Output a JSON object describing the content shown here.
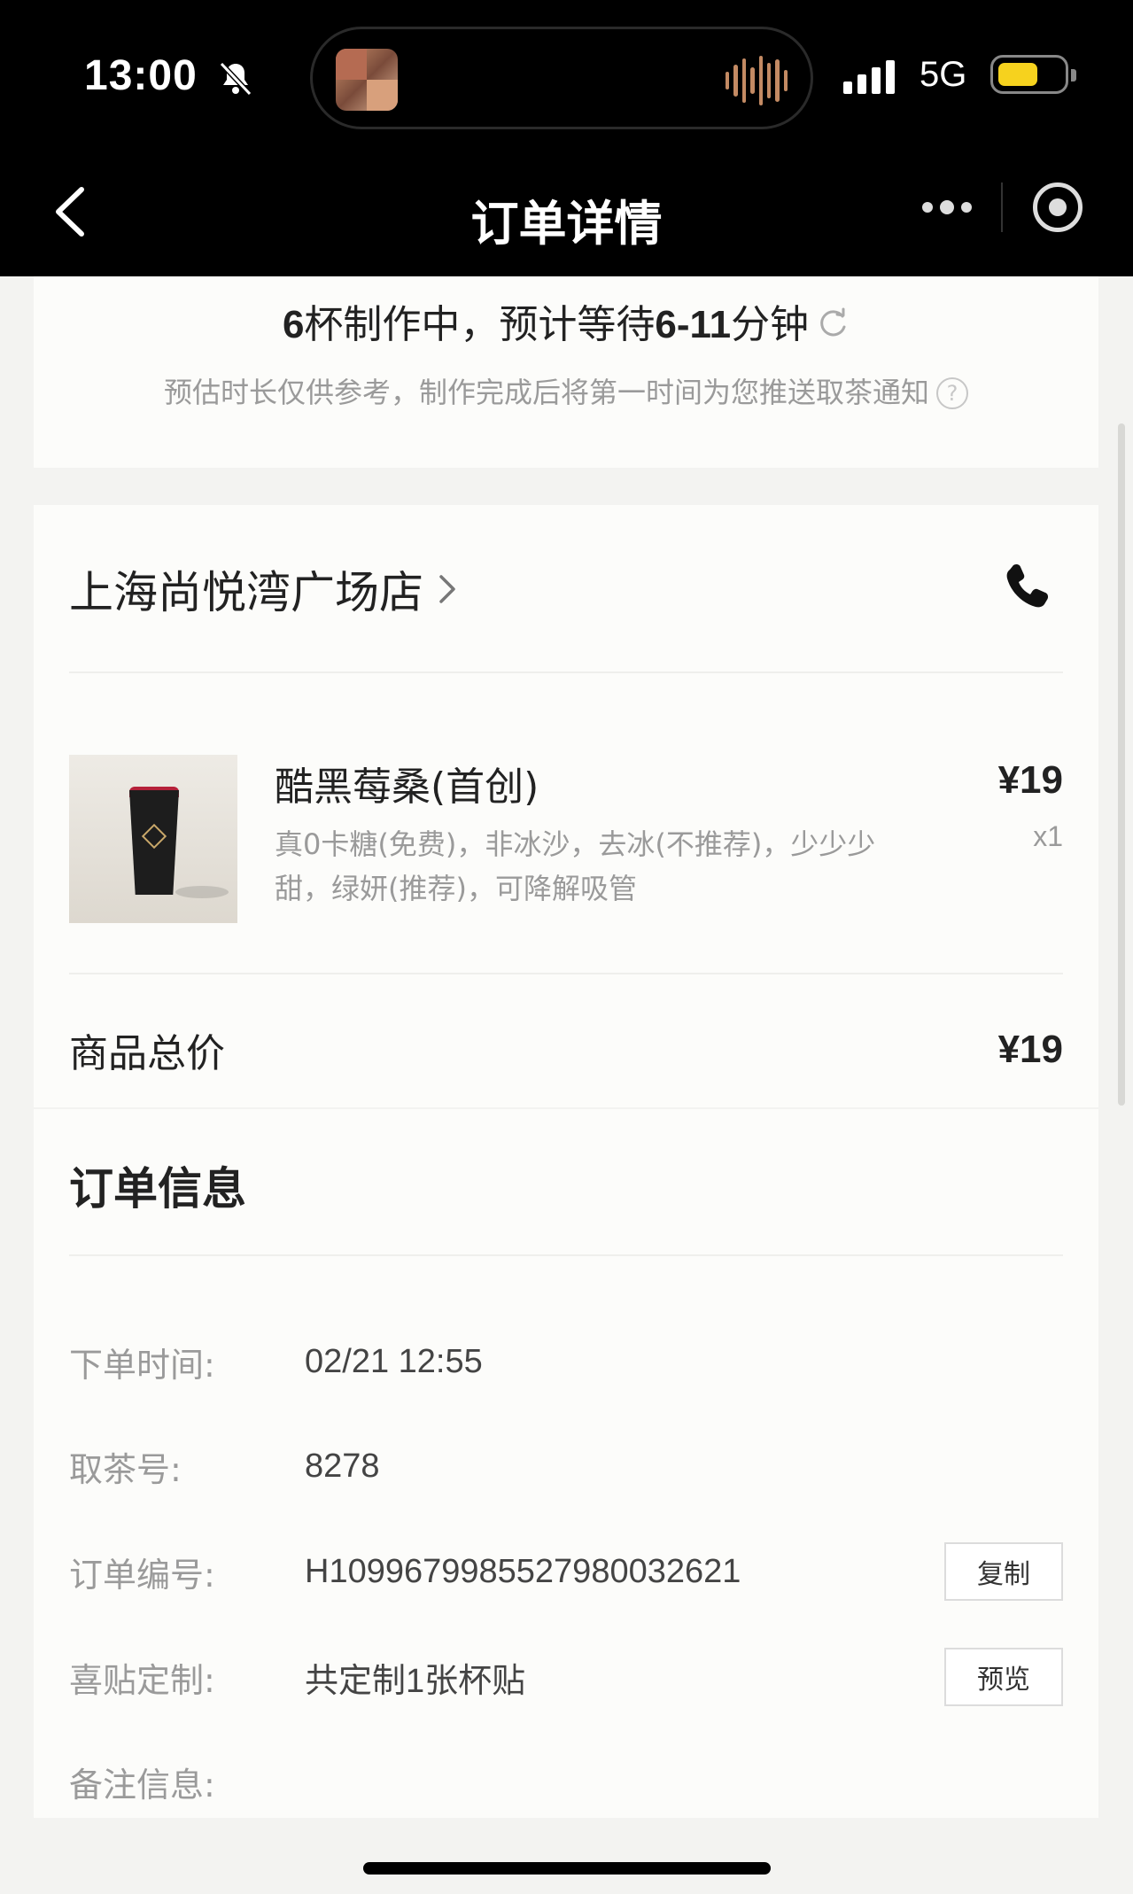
{
  "status_bar": {
    "time": "13:00",
    "network": "5G",
    "battery_color": "#f6d21e"
  },
  "nav": {
    "title": "订单详情",
    "icons": [
      "chevron-left-icon",
      "more-icon",
      "target-icon"
    ]
  },
  "progress": {
    "cups": "6",
    "text_a": "杯制作中，预计等待",
    "range": "6-11",
    "text_b": "分钟",
    "hint": "预估时长仅供参考，制作完成后将第一时间为您推送取茶通知",
    "help_glyph": "?"
  },
  "store": {
    "name": "上海尚悦湾广场店"
  },
  "product": {
    "name": "酷黑莓桑(首创)",
    "options": "真0卡糖(免费)，非冰沙，去冰(不推荐)，少少少甜，绿妍(推荐)，可降解吸管",
    "price": "¥19",
    "qty": "x1"
  },
  "total": {
    "label": "商品总价",
    "value": "¥19"
  },
  "order_info": {
    "title": "订单信息",
    "rows": [
      {
        "label": "下单时间:",
        "value": "02/21 12:55"
      },
      {
        "label": "取茶号:",
        "value": "8278"
      },
      {
        "label": "订单编号:",
        "value": "H1099679985527980032621",
        "button": "复制"
      },
      {
        "label": "喜贴定制:",
        "value": "共定制1张杯贴",
        "button": "预览"
      },
      {
        "label": "备注信息:",
        "value": ""
      }
    ]
  }
}
